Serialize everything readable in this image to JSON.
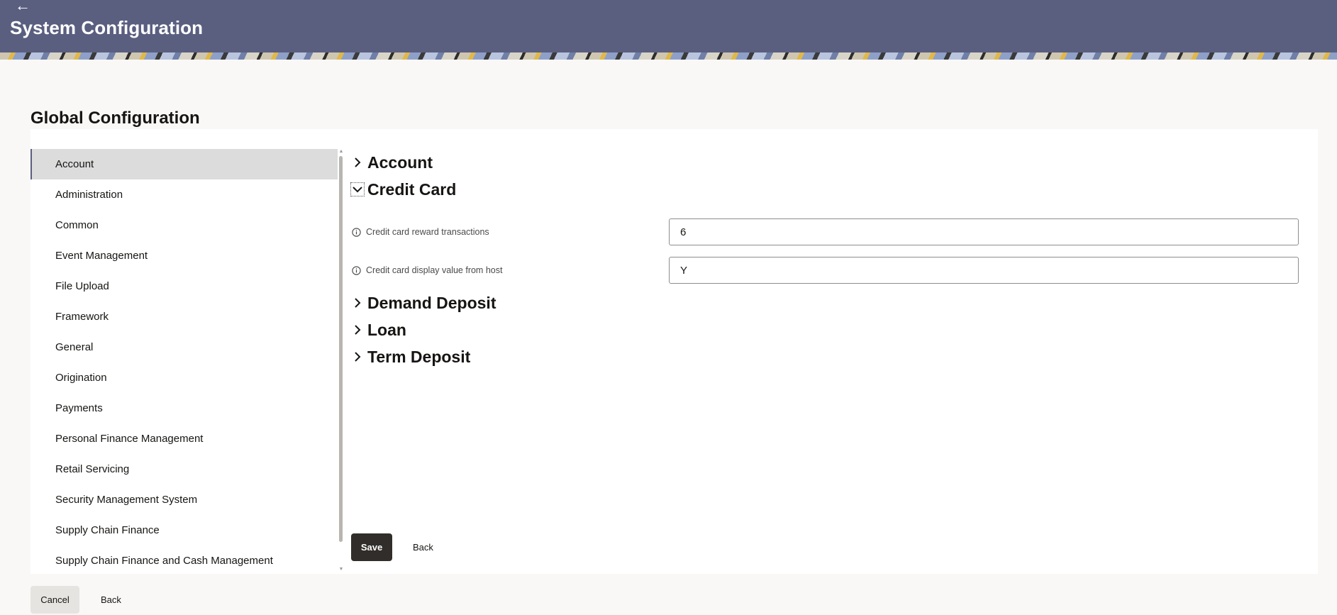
{
  "header": {
    "back_icon": "left-arrow-icon",
    "title": "System Configuration",
    "bg_color": "#5a5f80"
  },
  "section": {
    "title": "Global Configuration"
  },
  "sidebar": {
    "items": [
      {
        "label": "Account",
        "selected": true
      },
      {
        "label": "Administration"
      },
      {
        "label": "Common"
      },
      {
        "label": "Event Management"
      },
      {
        "label": "File Upload"
      },
      {
        "label": "Framework"
      },
      {
        "label": "General"
      },
      {
        "label": "Origination"
      },
      {
        "label": "Payments"
      },
      {
        "label": "Personal Finance Management"
      },
      {
        "label": "Retail Servicing"
      },
      {
        "label": "Security Management System"
      },
      {
        "label": "Supply Chain Finance"
      },
      {
        "label": "Supply Chain Finance and Cash Management"
      }
    ]
  },
  "content": {
    "accordions": [
      {
        "label": "Account",
        "expanded": false
      },
      {
        "label": "Credit Card",
        "expanded": true
      },
      {
        "label": "Demand Deposit",
        "expanded": false
      },
      {
        "label": "Loan",
        "expanded": false
      },
      {
        "label": "Term Deposit",
        "expanded": false
      }
    ],
    "fields": [
      {
        "label": "Credit card reward transactions",
        "value": "6",
        "icon": "info-icon"
      },
      {
        "label": "Credit card display value from host",
        "value": "Y",
        "icon": "info-icon"
      }
    ],
    "save_label": "Save",
    "back_label": "Back"
  },
  "footer": {
    "cancel_label": "Cancel",
    "back_label": "Back"
  }
}
